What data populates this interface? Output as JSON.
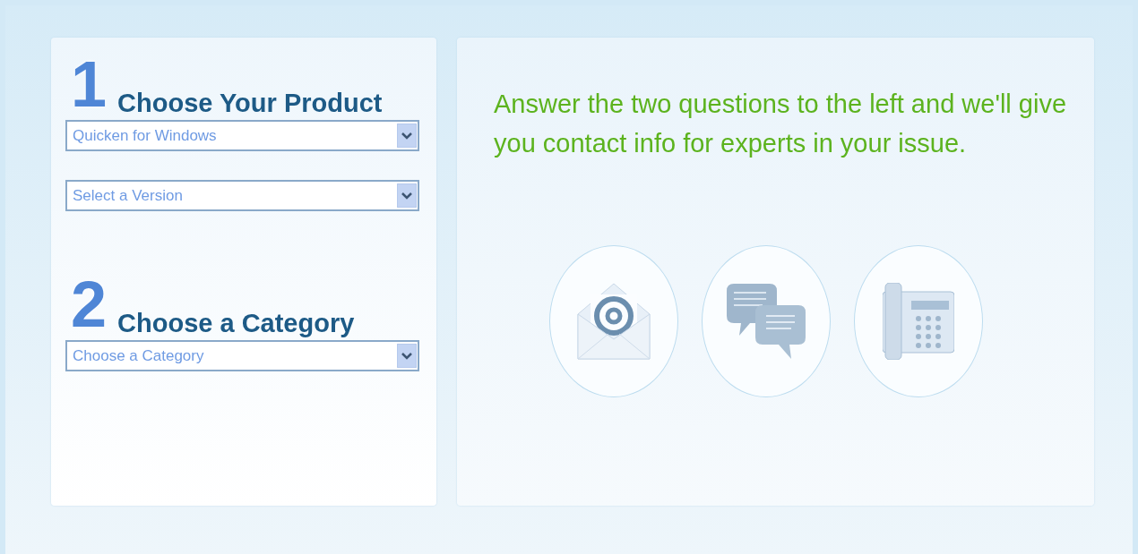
{
  "steps": [
    {
      "number": "1",
      "heading": "Choose Your Product",
      "selects": [
        {
          "value": "Quicken for Windows"
        },
        {
          "value": "Select a Version"
        }
      ]
    },
    {
      "number": "2",
      "heading": "Choose a Category",
      "selects": [
        {
          "value": "Choose a Category"
        }
      ]
    }
  ],
  "message": "Answer the two questions to the left and we'll give you contact info for experts in your issue.",
  "contact_options": [
    {
      "kind": "email"
    },
    {
      "kind": "chat"
    },
    {
      "kind": "phone"
    }
  ]
}
